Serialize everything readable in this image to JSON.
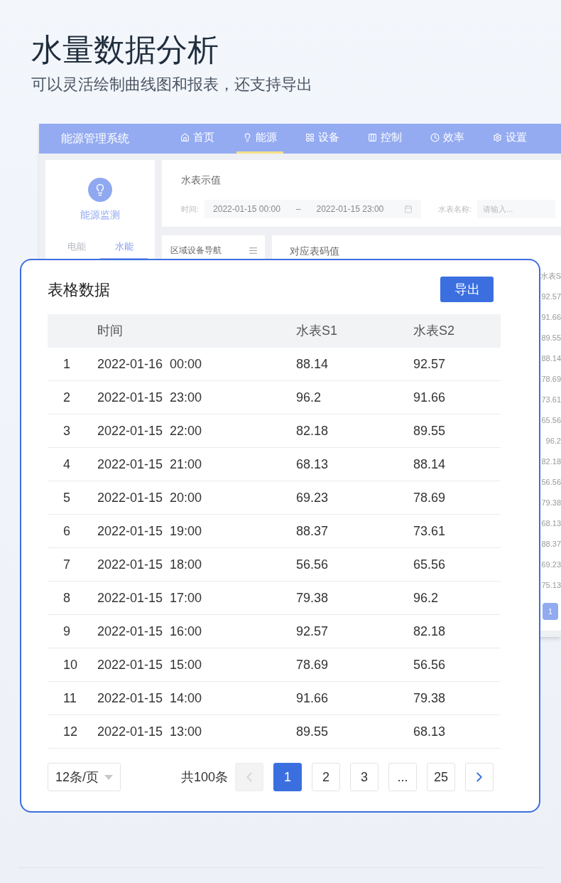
{
  "heading": {
    "title": "水量数据分析",
    "subtitle": "可以灵活绘制曲线图和报表，还支持导出"
  },
  "app": {
    "title": "能源管理系统",
    "nav": [
      {
        "label": "首页",
        "selected": false
      },
      {
        "label": "能源",
        "selected": true
      },
      {
        "label": "设备",
        "selected": false
      },
      {
        "label": "控制",
        "selected": false
      },
      {
        "label": "效率",
        "selected": false
      },
      {
        "label": "设置",
        "selected": false
      }
    ],
    "side": {
      "label": "能源监测",
      "tabs": [
        {
          "label": "电能",
          "selected": false
        },
        {
          "label": "水能",
          "selected": true
        }
      ]
    },
    "filter": {
      "title": "水表示值",
      "time_label": "时间:",
      "start": "2022-01-15  00:00",
      "separator": "–",
      "end": "2022-01-15  23:00",
      "name_label": "水表名称:",
      "name_placeholder": "请输入..."
    },
    "tree": {
      "title": "区域设备导航"
    },
    "readings": {
      "title": "对应表码值",
      "column_header": "水表S",
      "values": [
        "92.57",
        "91.66",
        "89.55",
        "88.14",
        "78.69",
        "73.61",
        "65.56",
        "96.2",
        "82.18",
        "56.56",
        "79.38",
        "68.13",
        "88.37",
        "69.23",
        "75.13"
      ],
      "page": "1"
    }
  },
  "card": {
    "title": "表格数据",
    "export": "导出",
    "columns": [
      "时间",
      "水表S1",
      "水表S2"
    ],
    "rows": [
      {
        "index": "1",
        "time": "2022-01-16  00:00",
        "s1": "88.14",
        "s2": "92.57"
      },
      {
        "index": "2",
        "time": "2022-01-15  23:00",
        "s1": "96.2",
        "s2": "91.66"
      },
      {
        "index": "3",
        "time": "2022-01-15  22:00",
        "s1": "82.18",
        "s2": "89.55"
      },
      {
        "index": "4",
        "time": "2022-01-15  21:00",
        "s1": "68.13",
        "s2": "88.14"
      },
      {
        "index": "5",
        "time": "2022-01-15  20:00",
        "s1": "69.23",
        "s2": "78.69"
      },
      {
        "index": "6",
        "time": "2022-01-15  19:00",
        "s1": "88.37",
        "s2": "73.61"
      },
      {
        "index": "7",
        "time": "2022-01-15  18:00",
        "s1": "56.56",
        "s2": "65.56"
      },
      {
        "index": "8",
        "time": "2022-01-15  17:00",
        "s1": "79.38",
        "s2": "96.2"
      },
      {
        "index": "9",
        "time": "2022-01-15  16:00",
        "s1": "92.57",
        "s2": "82.18"
      },
      {
        "index": "10",
        "time": "2022-01-15  15:00",
        "s1": "78.69",
        "s2": "56.56"
      },
      {
        "index": "11",
        "time": "2022-01-15  14:00",
        "s1": "91.66",
        "s2": "79.38"
      },
      {
        "index": "12",
        "time": "2022-01-15  13:00",
        "s1": "89.55",
        "s2": "68.13"
      }
    ],
    "pagination": {
      "page_size": "12条/页",
      "total": "共100条",
      "prev_disabled": true,
      "pages": [
        {
          "label": "1",
          "selected": true
        },
        {
          "label": "2",
          "selected": false
        },
        {
          "label": "3",
          "selected": false
        },
        {
          "label": "...",
          "selected": false
        },
        {
          "label": "25",
          "selected": false
        }
      ]
    }
  }
}
